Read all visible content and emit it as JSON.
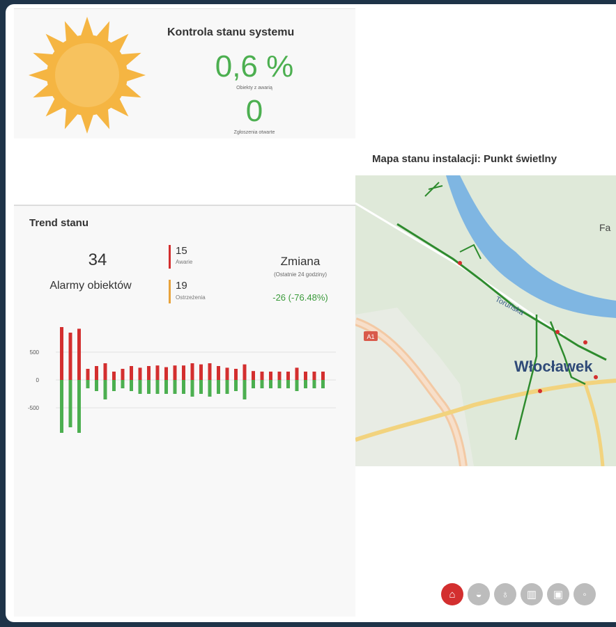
{
  "status": {
    "title": "Kontrola stanu systemu",
    "failed_percent": "0,6 %",
    "failed_label": "Obiekty z awarią",
    "open_reports": "0",
    "open_reports_label": "Zgłoszenia otwarte",
    "icon": "sun-icon",
    "sun_color": "#f5b542"
  },
  "trend": {
    "title": "Trend stanu",
    "alarm_count": "34",
    "alarm_label": "Alarmy obiektów",
    "failures_count": "15",
    "failures_label": "Awarie",
    "warnings_count": "19",
    "warnings_label": "Ostrzeżenia",
    "change_title": "Zmiana",
    "change_subtitle": "(Ostatnie 24 godziny)",
    "change_value": "-26 (-76.48%)",
    "failure_color": "#d32f2f",
    "warning_color": "#e8a33c",
    "positive_color": "#4caf50"
  },
  "chart_data": {
    "type": "bar",
    "yticks": [
      "500",
      "0",
      "-500"
    ],
    "ylim": [
      -1000,
      1000
    ],
    "grid": true,
    "series": [
      {
        "values": [
          950,
          850,
          920,
          200,
          250,
          300,
          150,
          200,
          250,
          220,
          250,
          260,
          230,
          260,
          260,
          300,
          280,
          300,
          250,
          220,
          200,
          280,
          160,
          150,
          150,
          150,
          150,
          220,
          150,
          150,
          150
        ]
      },
      {
        "values": [
          -950,
          -850,
          -950,
          -150,
          -200,
          -350,
          -200,
          -150,
          -200,
          -250,
          -250,
          -250,
          -250,
          -250,
          -250,
          -300,
          -250,
          -300,
          -250,
          -250,
          -200,
          -350,
          -150,
          -150,
          -150,
          -150,
          -150,
          -200,
          -150,
          -150,
          -150
        ]
      }
    ]
  },
  "map": {
    "title": "Mapa stanu instalacji: Punkt świetlny",
    "city_label": "Włocławek",
    "place_label": "Fa",
    "road_badge": "A1",
    "street_label": "Toruńska"
  },
  "nav": [
    {
      "icon": "home-icon",
      "glyph": "⌂"
    },
    {
      "icon": "lamp-icon",
      "glyph": "◒"
    },
    {
      "icon": "bulb-icon",
      "glyph": "♁"
    },
    {
      "icon": "cabinet-icon",
      "glyph": "▥"
    },
    {
      "icon": "image-icon",
      "glyph": "▣"
    },
    {
      "icon": "more-icon",
      "glyph": "◦"
    }
  ]
}
